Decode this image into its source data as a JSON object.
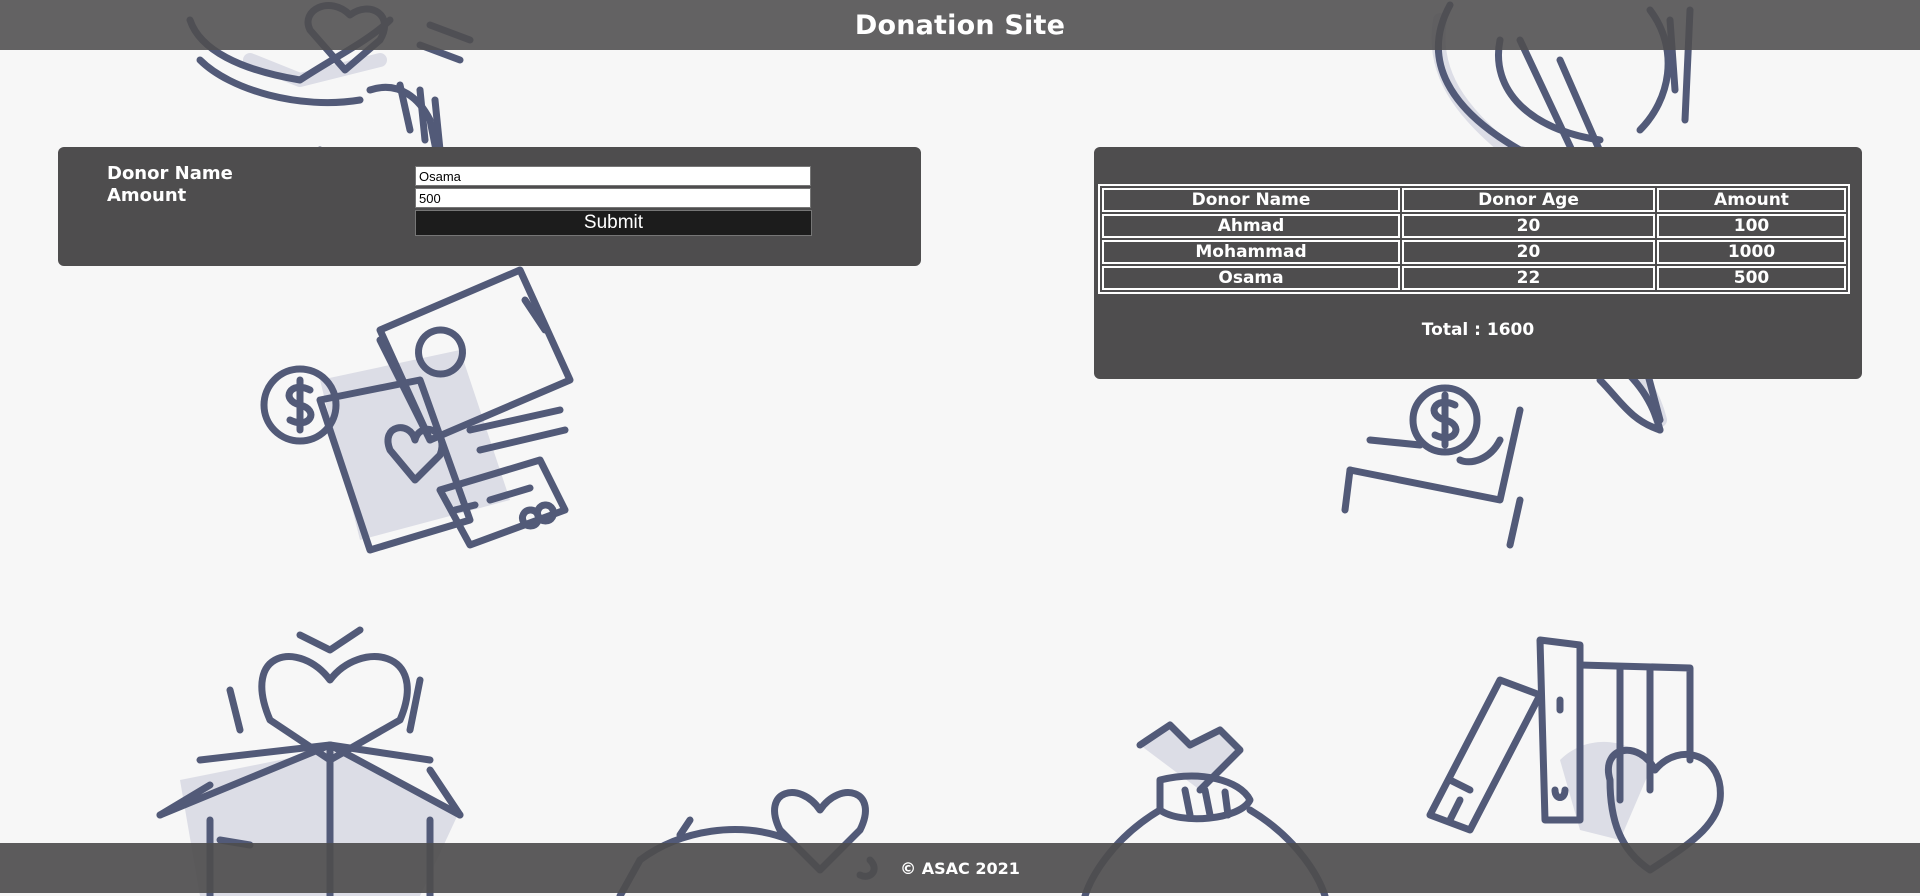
{
  "header": {
    "title": "Donation Site"
  },
  "form": {
    "donor_name_label": "Donor Name",
    "amount_label": "Amount",
    "donor_name_value": "Osama",
    "amount_value": "500",
    "submit_label": "Submit"
  },
  "table": {
    "columns": [
      "Donor Name",
      "Donor Age",
      "Amount"
    ],
    "rows": [
      {
        "name": "Ahmad",
        "age": "20",
        "amount": "100"
      },
      {
        "name": "Mohammad",
        "age": "20",
        "amount": "1000"
      },
      {
        "name": "Osama",
        "age": "22",
        "amount": "500"
      }
    ],
    "total_text": "Total : 1600"
  },
  "footer": {
    "text": "© ASAC 2021"
  },
  "colors": {
    "page_background": "#f7f7f7",
    "panel": "#4e4d4e",
    "bar": "#4e4d4e",
    "button": "#1c1c1c",
    "illustration_stroke": "#525a78",
    "illustration_shadow": "#dcdde6"
  },
  "background_icons": [
    "hands-heart-icon",
    "ribbon-icon",
    "money-wallet-card-icon",
    "hand-coin-icon",
    "heart-box-icon",
    "piggy-heart-icon",
    "money-bag-icon",
    "books-heart-icon"
  ]
}
